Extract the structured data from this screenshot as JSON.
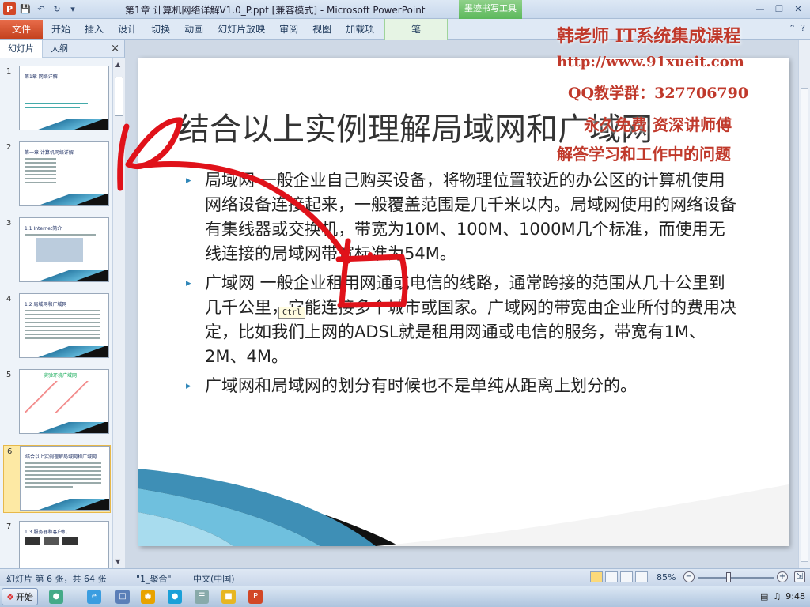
{
  "window": {
    "title": "第1章 计算机网络详解V1.0_P.ppt [兼容模式] - Microsoft PowerPoint",
    "context_tab_header": "墨迹书写工具"
  },
  "ribbon": {
    "file_label": "文件",
    "tabs": [
      "开始",
      "插入",
      "设计",
      "切换",
      "动画",
      "幻灯片放映",
      "审阅",
      "视图",
      "加载项"
    ],
    "context_tab": "笔"
  },
  "pane": {
    "tabs": [
      "幻灯片",
      "大纲"
    ],
    "close": "×"
  },
  "thumbnails": [
    {
      "num": "1",
      "title": "第1章 网络详解"
    },
    {
      "num": "2",
      "title": "第一章 计算机网络详解"
    },
    {
      "num": "3",
      "title": "1.1 Internet简介"
    },
    {
      "num": "4",
      "title": "1.2 局域网和广域网"
    },
    {
      "num": "5",
      "title": "实验环境广域网"
    },
    {
      "num": "6",
      "title": "结合以上实例理解局域网和广域网"
    },
    {
      "num": "7",
      "title": "1.3 服务器和客户机"
    }
  ],
  "slide": {
    "title": "结合以上实例理解局域网和广域网",
    "bullets": [
      "局域网 一般企业自己购买设备，将物理位置较近的办公区的计算机使用网络设备连接起来，一般覆盖范围是几千米以内。局域网使用的网络设备有集线器或交换机，带宽为10M、100M、1000M几个标准，而使用无线连接的局域网带宽标准为54M。",
      "广域网 一般企业租用网通或电信的线路，通常跨接的范围从几十公里到几千公里，它能连接多个城市或国家。广域网的带宽由企业所付的费用决定，比如我们上网的ADSL就是租用网通或电信的服务，带宽有1M、2M、4M。",
      "广域网和局域网的划分有时候也不是单纯从距离上划分的。"
    ],
    "tooltip": "Ctrl"
  },
  "watermark": {
    "line1": "韩老师 IT系统集成课程",
    "line2": "http://www.91xueit.com",
    "line3": "QQ教学群：327706790",
    "line4": "永久免费 资深讲师傅",
    "line5": "解答学习和工作中的问题"
  },
  "status": {
    "slide_info": "幻灯片 第 6 张，共 64 张",
    "theme": "\"1_聚合\"",
    "language": "中文(中国)",
    "zoom": "85%"
  },
  "taskbar": {
    "start": "开始",
    "time": "9:48"
  },
  "colors": {
    "accent_file": "#d24726",
    "ink": "#e0121a",
    "bullet": "#2e86b8",
    "watermark": "#c0392b"
  }
}
